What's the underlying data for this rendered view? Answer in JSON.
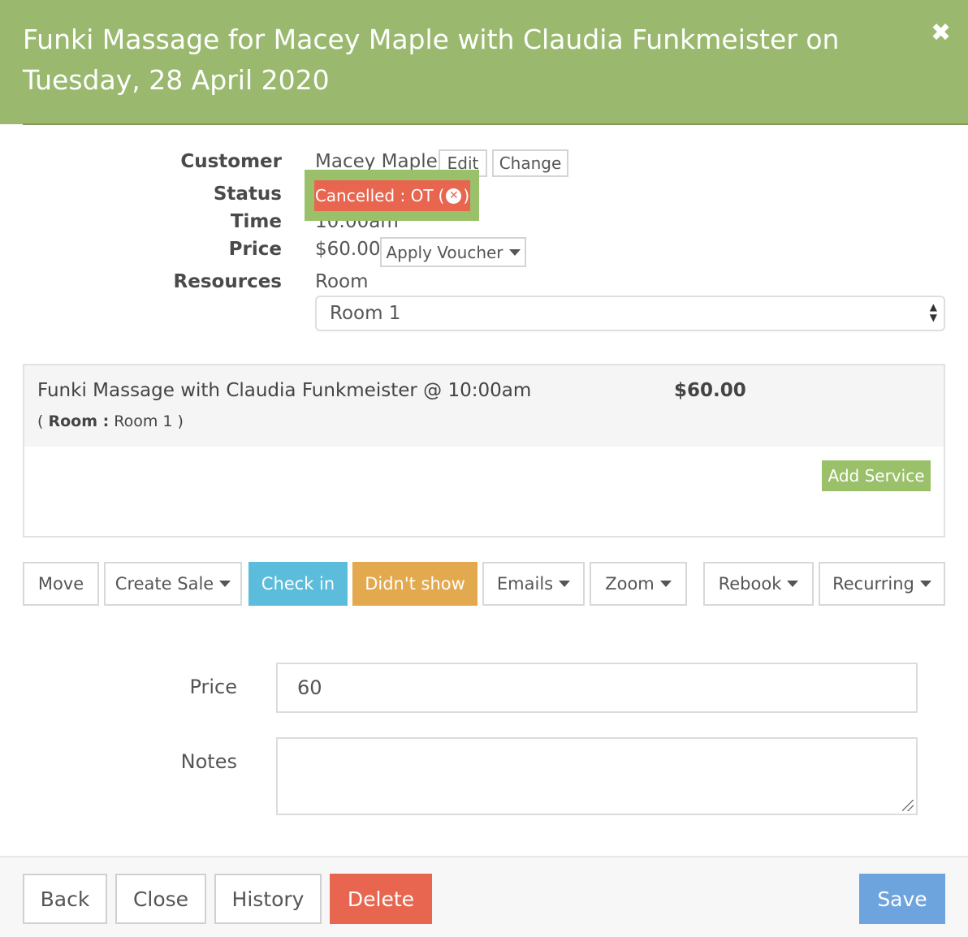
{
  "modal": {
    "title": "Funki Massage for Macey Maple with Claudia Funkmeister on Tuesday, 28 April 2020",
    "close_glyph": "✖"
  },
  "details": {
    "customer_label": "Customer",
    "customer_name": "Macey Maple",
    "edit_label": "Edit",
    "change_label": "Change",
    "status_label": "Status",
    "status_value": "Cancelled : OT",
    "time_label": "Time",
    "time_value": "10:00am",
    "price_label": "Price",
    "price_value": "$60.00",
    "voucher_label": "Apply Voucher",
    "resources_label": "Resources",
    "resource_type": "Room",
    "resource_selected": "Room 1"
  },
  "service": {
    "name": "Funki Massage with Claudia Funkmeister @ 10:00am",
    "sub_open": "( ",
    "sub_key": "Room :",
    "sub_value": " Room 1 )",
    "price": "$60.00",
    "add_label": "Add Service"
  },
  "actions": {
    "move": "Move",
    "create_sale": "Create Sale",
    "check_in": "Check in",
    "didnt_show": "Didn't show",
    "emails": "Emails",
    "zoom": "Zoom",
    "rebook": "Rebook",
    "recurring": "Recurring"
  },
  "form": {
    "price_label": "Price",
    "price_value": "60",
    "notes_label": "Notes",
    "notes_value": ""
  },
  "footer": {
    "back": "Back",
    "close": "Close",
    "history": "History",
    "delete": "Delete",
    "save": "Save"
  },
  "colors": {
    "header": "#9ab96f",
    "status": "#e8664f",
    "check_in": "#5bbcdc",
    "didnt_show": "#e3a94f",
    "save": "#6ea4dd",
    "add_service": "#9ac06a"
  }
}
